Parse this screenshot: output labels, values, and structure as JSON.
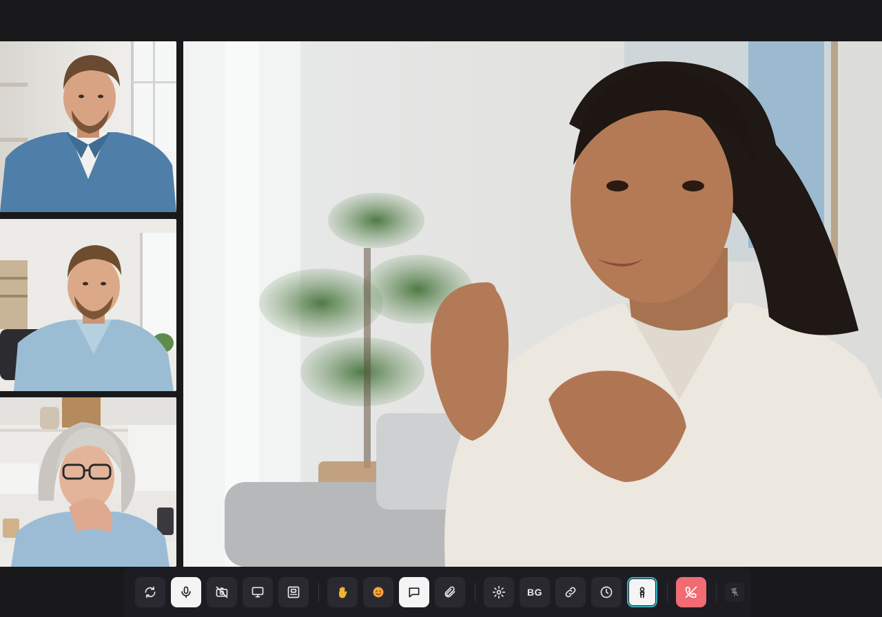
{
  "participants": [
    {
      "id": "man-denim-shirt",
      "role": "thumbnail"
    },
    {
      "id": "man-light-blue-shirt",
      "role": "thumbnail"
    },
    {
      "id": "woman-gray-hair-glasses",
      "role": "thumbnail"
    }
  ],
  "main_speaker": {
    "id": "woman-curly-hair-white-blouse"
  },
  "controls": {
    "background_label": "BG",
    "buttons": [
      {
        "name": "switch-camera",
        "icon": "refresh-icon",
        "state": "default"
      },
      {
        "name": "microphone",
        "icon": "microphone-icon",
        "state": "active"
      },
      {
        "name": "camera-off",
        "icon": "camera-off-icon",
        "state": "default"
      },
      {
        "name": "share-screen",
        "icon": "monitor-icon",
        "state": "default"
      },
      {
        "name": "layout",
        "icon": "grid-layout-icon",
        "state": "default"
      },
      {
        "name": "raise-hand",
        "icon": "hand-icon",
        "state": "default"
      },
      {
        "name": "reactions",
        "icon": "smile-emoji-icon",
        "state": "default"
      },
      {
        "name": "chat",
        "icon": "chat-bubble-icon",
        "state": "active"
      },
      {
        "name": "attach",
        "icon": "paperclip-icon",
        "state": "default"
      },
      {
        "name": "settings",
        "icon": "gear-icon",
        "state": "default"
      },
      {
        "name": "background",
        "icon": "bg-text",
        "state": "default"
      },
      {
        "name": "link",
        "icon": "link-icon",
        "state": "default"
      },
      {
        "name": "timer",
        "icon": "clock-icon",
        "state": "default"
      },
      {
        "name": "accessibility",
        "icon": "person-icon",
        "state": "selected"
      },
      {
        "name": "end-call",
        "icon": "phone-hangup-icon",
        "state": "danger"
      },
      {
        "name": "unpin",
        "icon": "pin-off-icon",
        "state": "muted"
      }
    ]
  },
  "colors": {
    "app_background": "#19191b",
    "control_bar": "#1d1c22",
    "button": "#2a2930",
    "button_active": "#f4f4f5",
    "selected_outline": "#37b3c2",
    "end_call": "#f16b72",
    "hand_emoji": "#f2b531",
    "smile_emoji": "#f4a43a"
  }
}
